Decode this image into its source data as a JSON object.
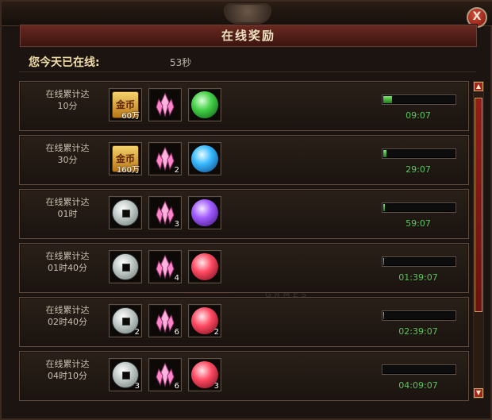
{
  "window": {
    "title": "在线奖励",
    "close_label": "X"
  },
  "online": {
    "label": "您今天已在线:",
    "value": "53秒"
  },
  "watermark": {
    "main": "游戏",
    "sub": "GAMES"
  },
  "rows": [
    {
      "label_line1": "在线累计达",
      "label_line2": "10分",
      "items": [
        {
          "icon": "gold-ingot-icon",
          "text": "金币",
          "qty": "60万"
        },
        {
          "icon": "pink-crystal-icon",
          "qty": ""
        },
        {
          "icon": "green-orb-icon",
          "qty": ""
        }
      ],
      "progress": 0.12,
      "timer": "09:07"
    },
    {
      "label_line1": "在线累计达",
      "label_line2": "30分",
      "items": [
        {
          "icon": "gold-ingot-icon",
          "text": "金币",
          "qty": "160万"
        },
        {
          "icon": "pink-crystal-icon",
          "qty": "2"
        },
        {
          "icon": "blue-orb-icon",
          "qty": ""
        }
      ],
      "progress": 0.04,
      "timer": "29:07"
    },
    {
      "label_line1": "在线累计达",
      "label_line2": "01时",
      "items": [
        {
          "icon": "silver-coin-icon",
          "qty": ""
        },
        {
          "icon": "pink-crystal-icon",
          "qty": "3"
        },
        {
          "icon": "purple-orb-icon",
          "qty": ""
        }
      ],
      "progress": 0.02,
      "timer": "59:07"
    },
    {
      "label_line1": "在线累计达",
      "label_line2": "01时40分",
      "items": [
        {
          "icon": "silver-coin-icon",
          "qty": ""
        },
        {
          "icon": "pink-crystal-icon",
          "qty": "4"
        },
        {
          "icon": "red-orb-icon",
          "qty": ""
        }
      ],
      "progress": 0.01,
      "timer": "01:39:07"
    },
    {
      "label_line1": "在线累计达",
      "label_line2": "02时40分",
      "items": [
        {
          "icon": "silver-coin-icon",
          "qty": "2"
        },
        {
          "icon": "pink-crystal-icon",
          "qty": "6"
        },
        {
          "icon": "red-orb-icon",
          "qty": "2"
        }
      ],
      "progress": 0.01,
      "timer": "02:39:07"
    },
    {
      "label_line1": "在线累计达",
      "label_line2": "04时10分",
      "items": [
        {
          "icon": "silver-coin-icon",
          "qty": "3"
        },
        {
          "icon": "pink-crystal-icon",
          "qty": "6"
        },
        {
          "icon": "red-orb-icon",
          "qty": "3"
        }
      ],
      "progress": 0.0,
      "timer": "04:09:07"
    }
  ],
  "colors": {
    "title_red": "#6a2a21",
    "progress_green": "#46b33c",
    "timer_green": "#59c55a"
  }
}
